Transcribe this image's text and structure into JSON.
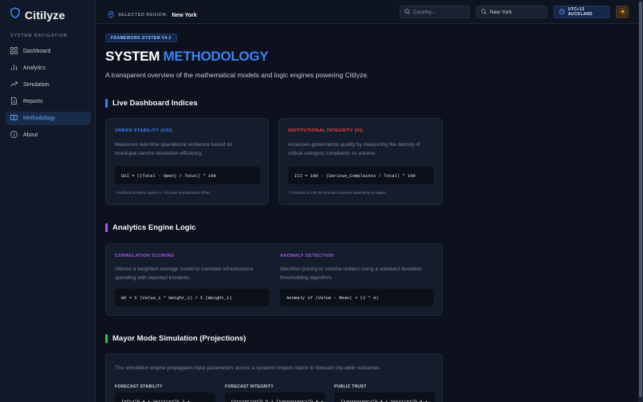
{
  "app": {
    "name": "Citilyze"
  },
  "sidebar": {
    "heading": "SYSTEM NAVIGATION",
    "items": [
      {
        "label": "Dashboard",
        "icon": "grid-icon"
      },
      {
        "label": "Analytics",
        "icon": "bar-chart-icon"
      },
      {
        "label": "Simulation",
        "icon": "trend-icon"
      },
      {
        "label": "Reports",
        "icon": "document-icon"
      },
      {
        "label": "Methodology",
        "icon": "book-icon",
        "active": true
      },
      {
        "label": "About",
        "icon": "info-icon"
      }
    ]
  },
  "topbar": {
    "region_label": "SELECTED REGION:",
    "region_value": "New York",
    "country_placeholder": "Country...",
    "city_value": "New York",
    "timezone": "UTC+13 AUCKLAND"
  },
  "page": {
    "badge": "FRAMEWORK SYSTEM V4.2",
    "title_part1": "SYSTEM",
    "title_part2": "METHODOLOGY",
    "subtitle": "A transparent overview of the mathematical models and logic engines powering Citilyze."
  },
  "sections": {
    "dashboard": {
      "title": "Live Dashboard Indices",
      "cards": [
        {
          "label": "URBAN STABILITY (USI)",
          "desc_line1": "Measures real-time operational resilience based on",
          "desc_line2": "municipal service resolution efficiency.",
          "formula": "USI = ((Total - Open) / Total) * 100",
          "note": "* Auckland baseline applies a +20 point normalization offset."
        },
        {
          "label": "INSTITUTIONAL INTEGRITY (III)",
          "desc_line1": "Assesses governance quality by measuring the density of",
          "desc_line2": "critical category complaints vs volume.",
          "formula": "III = 100 - (Serious_Complaints / Total) * 100",
          "note": "* Clamped at a 30-40 minimum baseline depending on region."
        }
      ]
    },
    "analytics": {
      "title": "Analytics Engine Logic",
      "items": [
        {
          "label": "CORRELATION SCORING",
          "desc_line1": "Utilizes a weighted average model to correlate infrastructure",
          "desc_line2": "spending with reported incidents.",
          "formula": "WS = Σ (Value_i * Weight_i) / Σ (Weight_i)"
        },
        {
          "label": "ANOMALY DETECTION",
          "desc_line1": "Identifies pricing or volume outliers using a standard deviation",
          "desc_line2": "thresholding algorithm.",
          "formula": "Anomaly if |Value - Mean| > (2 * σ)"
        }
      ]
    },
    "simulation": {
      "title": "Mayor Mode Simulation (Projections)",
      "desc": "The simulation engine propagates input parameters across a systemic impact matrix to forecast city-wide outcomes.",
      "columns": [
        {
          "label": "FORECAST STABILITY",
          "formula": "Infra*0.4 + Services*0.3 +"
        },
        {
          "label": "FORECAST INTEGRITY",
          "formula": "Corruption*0.5 + Transparency*0.4 +"
        },
        {
          "label": "PUBLIC TRUST",
          "formula": "Transparency*0.4 + Services*0.4 +"
        }
      ]
    }
  },
  "colors": {
    "accent_blue": "#3b82f6",
    "usi_label": "#3b82f6",
    "iii_label": "#ef4444",
    "analytics_purple": "#a855f7",
    "simulation_green": "#22c55e"
  }
}
